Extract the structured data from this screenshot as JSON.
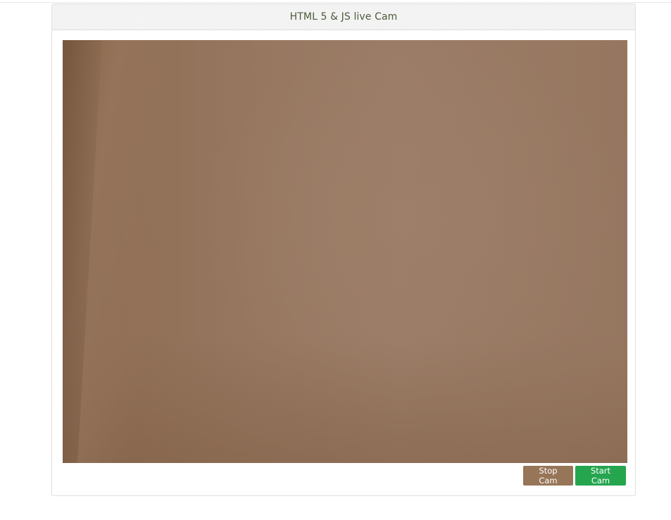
{
  "panel": {
    "title": "HTML 5 & JS live Cam"
  },
  "camera": {
    "state": "live video feed"
  },
  "controls": {
    "stop_label": "Stop Cam",
    "start_label": "Start Cam"
  },
  "colors": {
    "title_text": "#4d5b3a",
    "stop_button": "#977558",
    "start_button": "#26a54f",
    "video_tone": "#9a7a62"
  }
}
